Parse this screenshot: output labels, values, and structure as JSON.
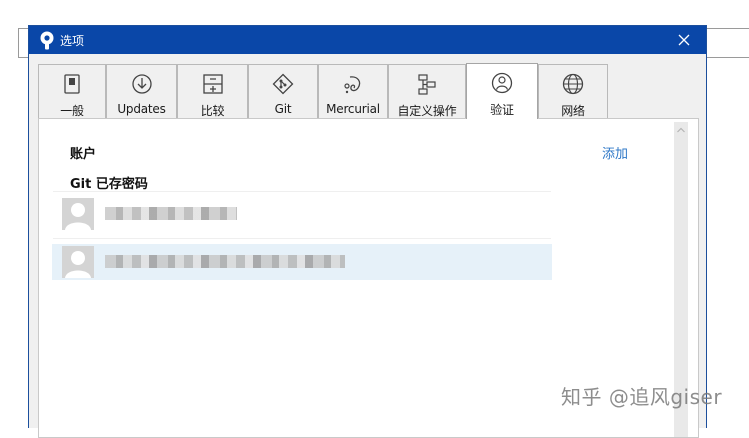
{
  "window": {
    "title": "选项",
    "close_symbol": "✕"
  },
  "tabs": [
    {
      "label": "一般",
      "icon": "switch-icon"
    },
    {
      "label": "Updates",
      "icon": "download-circle-icon"
    },
    {
      "label": "比较",
      "icon": "compare-icon"
    },
    {
      "label": "Git",
      "icon": "git-icon"
    },
    {
      "label": "Mercurial",
      "icon": "mercurial-icon"
    },
    {
      "label": "自定义操作",
      "icon": "custom-action-icon"
    },
    {
      "label": "验证",
      "icon": "user-circle-icon",
      "active": true
    },
    {
      "label": "网络",
      "icon": "globe-icon"
    }
  ],
  "auth": {
    "accounts_label": "账户",
    "add_label": "添加",
    "git_saved_label": "Git 已存密码"
  },
  "watermark": "知乎 @追风giser",
  "colors": {
    "titlebar": "#0a47a8",
    "link": "#2f78c7",
    "selected_row": "#e6f1f9"
  }
}
